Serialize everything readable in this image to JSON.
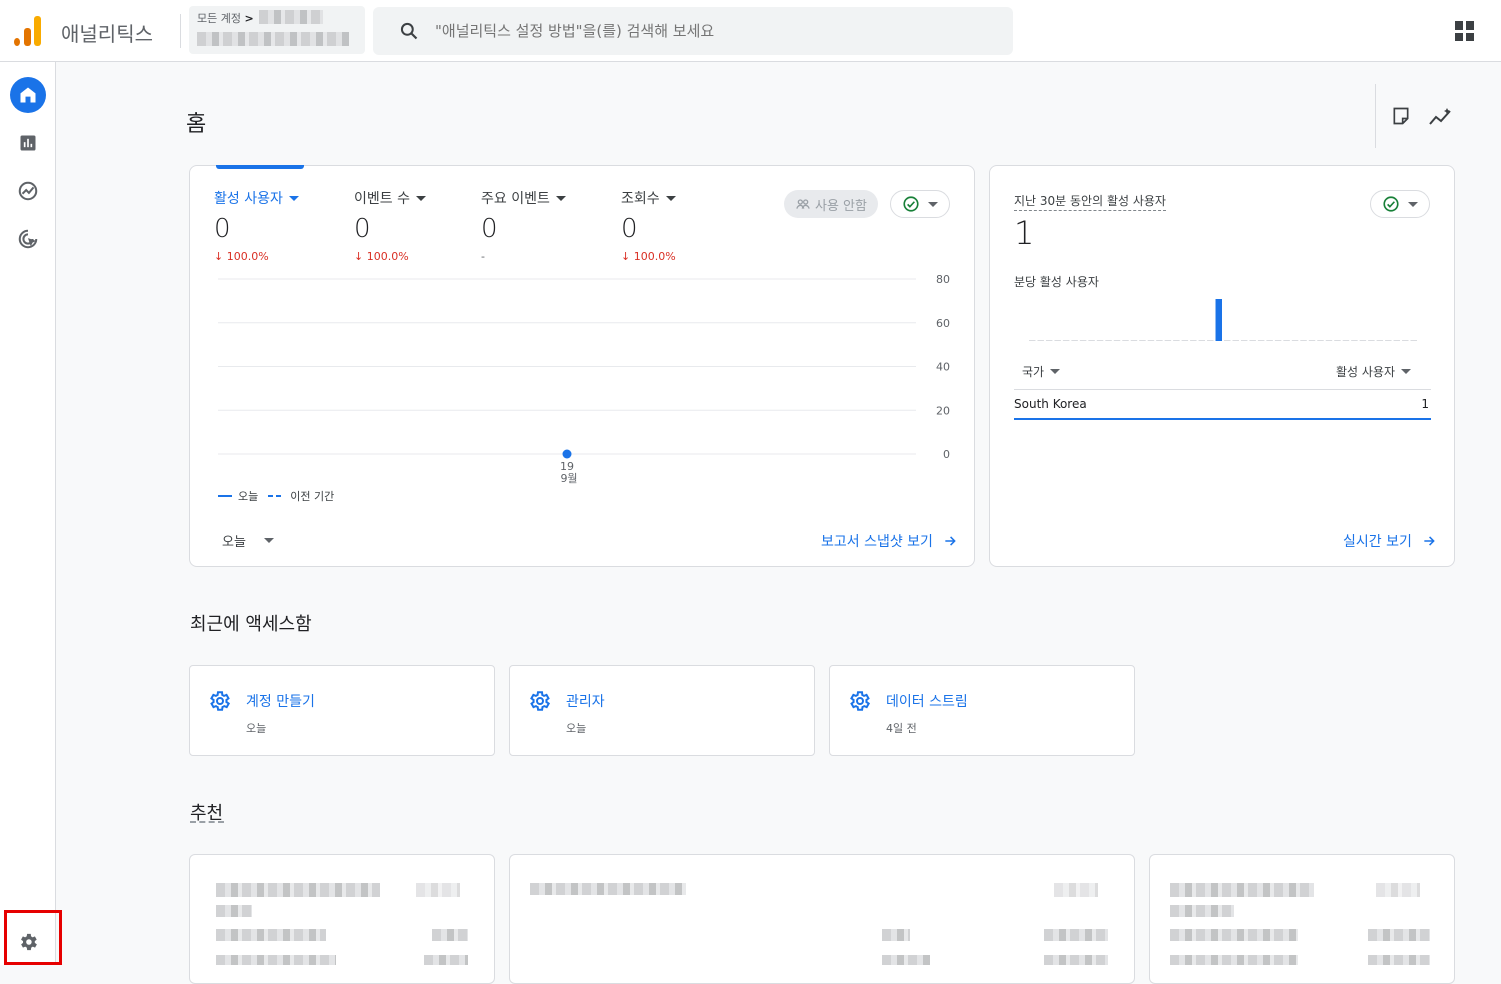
{
  "app": {
    "name": "애널리틱스",
    "account_crumb": "모든 계정",
    "search_placeholder": "\"애널리틱스 설정 방법\"을(를) 검색해 보세요"
  },
  "nav": [
    {
      "name": "home-icon",
      "active": true
    },
    {
      "name": "reports-icon",
      "active": false
    },
    {
      "name": "explore-icon",
      "active": false
    },
    {
      "name": "advertising-icon",
      "active": false
    },
    {
      "name": "admin-gear-icon",
      "active": false
    }
  ],
  "home": {
    "title": "홈",
    "metrics": [
      {
        "label": "활성 사용자",
        "value": "0",
        "change": "↓ 100.0%"
      },
      {
        "label": "이벤트 수",
        "value": "0",
        "change": "↓ 100.0%"
      },
      {
        "label": "주요 이벤트",
        "value": "0",
        "change": "-"
      },
      {
        "label": "조회수",
        "value": "0",
        "change": "↓ 100.0%"
      }
    ],
    "disabled_pill": "사용 안함",
    "legend_today": "오늘",
    "legend_previous": "이전 기간",
    "date_range": "오늘",
    "snapshot_link": "보고서 스냅샷 보기"
  },
  "chart_data": {
    "type": "line",
    "x": [
      "19 9월"
    ],
    "series": [
      {
        "name": "오늘",
        "values": [
          0
        ]
      },
      {
        "name": "이전 기간",
        "values": []
      }
    ],
    "yticks": [
      "80",
      "60",
      "40",
      "20",
      "0"
    ],
    "xtick_day": "19",
    "xtick_month": "9월",
    "ylim": [
      0,
      80
    ],
    "grid": true,
    "legend": "bottom-left",
    "colors": {
      "series": "#1a73e8"
    }
  },
  "realtime": {
    "label": "지난 30분 동안의 활성 사용자",
    "value": "1",
    "per_minute_label": "분당 활성 사용자",
    "per_minute_bars": [
      0,
      0,
      0,
      0,
      0,
      0,
      0,
      0,
      0,
      0,
      0,
      0,
      0,
      0,
      0,
      0,
      0,
      0,
      0,
      0,
      0,
      0,
      1,
      0,
      0,
      0,
      0,
      0,
      0,
      0,
      0,
      0,
      0,
      0,
      0,
      0,
      0,
      0,
      0,
      0,
      0,
      0,
      0,
      0,
      0,
      0
    ],
    "col_country": "국가",
    "col_users": "활성 사용자",
    "rows": [
      {
        "country": "South Korea",
        "users": "1"
      }
    ],
    "link": "실시간 보기"
  },
  "recent": {
    "title": "최근에 액세스함",
    "items": [
      {
        "title": "계정 만들기",
        "time": "오늘"
      },
      {
        "title": "관리자",
        "time": "오늘"
      },
      {
        "title": "데이터 스트림",
        "time": "4일 전"
      }
    ]
  },
  "recommended": {
    "title": "추천"
  },
  "colors": {
    "accent": "#1a73e8",
    "negative": "#d93025",
    "success": "#188038",
    "highlight": "#e60000"
  }
}
